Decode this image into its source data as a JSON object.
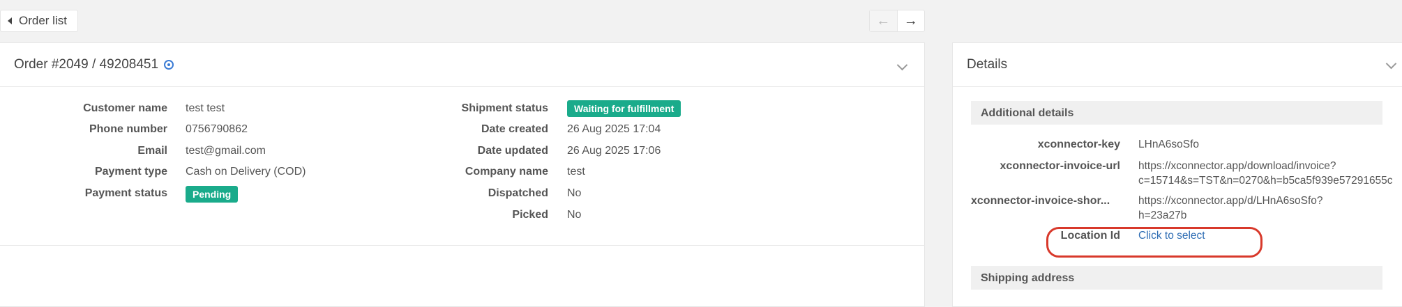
{
  "toolbar": {
    "back_label": "Order list"
  },
  "order": {
    "title": "Order #2049 / 49208451",
    "left_fields": [
      {
        "label": "Customer name",
        "value": "test test"
      },
      {
        "label": "Phone number",
        "value": "0756790862"
      },
      {
        "label": "Email",
        "value": "test@gmail.com"
      },
      {
        "label": "Payment type",
        "value": "Cash on Delivery (COD)"
      },
      {
        "label": "Payment status",
        "badge": "Pending"
      }
    ],
    "right_fields": [
      {
        "label": "Shipment status",
        "badge": "Waiting for fulfillment"
      },
      {
        "label": "Date created",
        "value": "26 Aug 2025 17:04"
      },
      {
        "label": "Date updated",
        "value": "26 Aug 2025 17:06"
      },
      {
        "label": "Company name",
        "value": "test"
      },
      {
        "label": "Dispatched",
        "value": "No"
      },
      {
        "label": "Picked",
        "value": "No"
      }
    ]
  },
  "details": {
    "title": "Details",
    "additional_title": "Additional details",
    "fields": [
      {
        "label": "xconnector-key",
        "value_lines": [
          "LHnA6soSfo"
        ]
      },
      {
        "label": "xconnector-invoice-url",
        "value_lines": [
          "https://xconnector.app/download/invoice?",
          "c=15714&s=TST&n=0270&h=b5ca5f939e57291655c"
        ]
      },
      {
        "label": "xconnector-invoice-shor...",
        "value_lines": [
          "https://xconnector.app/d/LHnA6soSfo?",
          "h=23a27b"
        ]
      },
      {
        "label": "Location Id",
        "link": "Click to select"
      }
    ],
    "shipping_title": "Shipping address"
  },
  "colors": {
    "badge": "#1aab8b",
    "link": "#2e6db4",
    "highlight": "#d8392b"
  }
}
